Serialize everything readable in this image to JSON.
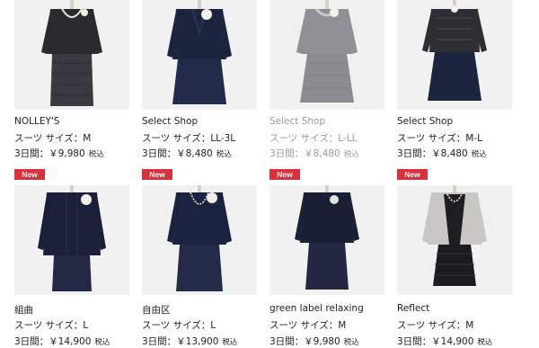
{
  "colors": {
    "badge": "#d8303c",
    "dimmed_text": "#9a9a9a"
  },
  "products": [
    {
      "badge": "",
      "brand": "NOLLEY'S",
      "size_line": "スーツ サイズ：M",
      "price": "3日間：￥9,980",
      "tax": "税込",
      "dimmed": false,
      "icon": "black-tweed-skirt-suit"
    },
    {
      "badge": "",
      "brand": "Select Shop",
      "size_line": "スーツ サイズ：LL-3L",
      "price": "3日間：￥8,480",
      "tax": "税込",
      "dimmed": false,
      "icon": "navy-skirt-suit-corsage"
    },
    {
      "badge": "",
      "brand": "Select Shop",
      "size_line": "スーツ サイズ：L-LL",
      "price": "3日間：￥8,480",
      "tax": "税込",
      "dimmed": true,
      "icon": "grey-tweed-dress-suit"
    },
    {
      "badge": "",
      "brand": "Select Shop",
      "size_line": "スーツ サイズ：M-L",
      "price": "3日間：￥8,480",
      "tax": "税込",
      "dimmed": false,
      "icon": "black-tweed-jacket-navy-skirt"
    },
    {
      "badge": "New",
      "brand": "組曲",
      "size_line": "スーツ サイズ：L",
      "price": "3日間：￥14,900",
      "tax": "税込",
      "dimmed": false,
      "icon": "navy-dress-suit-corsage"
    },
    {
      "badge": "New",
      "brand": "自由区",
      "size_line": "スーツ サイズ：L",
      "price": "3日間：￥13,900",
      "tax": "税込",
      "dimmed": false,
      "icon": "navy-suit-pearl-necklace"
    },
    {
      "badge": "New",
      "brand": "green label relaxing",
      "size_line": "スーツ サイズ：M",
      "price": "3日間：￥9,980",
      "tax": "税込",
      "dimmed": false,
      "icon": "navy-dress-suit-brooch"
    },
    {
      "badge": "New",
      "brand": "Reflect",
      "size_line": "スーツ サイズ：M",
      "price": "3日間：￥14,900",
      "tax": "税込",
      "dimmed": false,
      "icon": "tweed-jacket-black-lace-dress"
    }
  ]
}
